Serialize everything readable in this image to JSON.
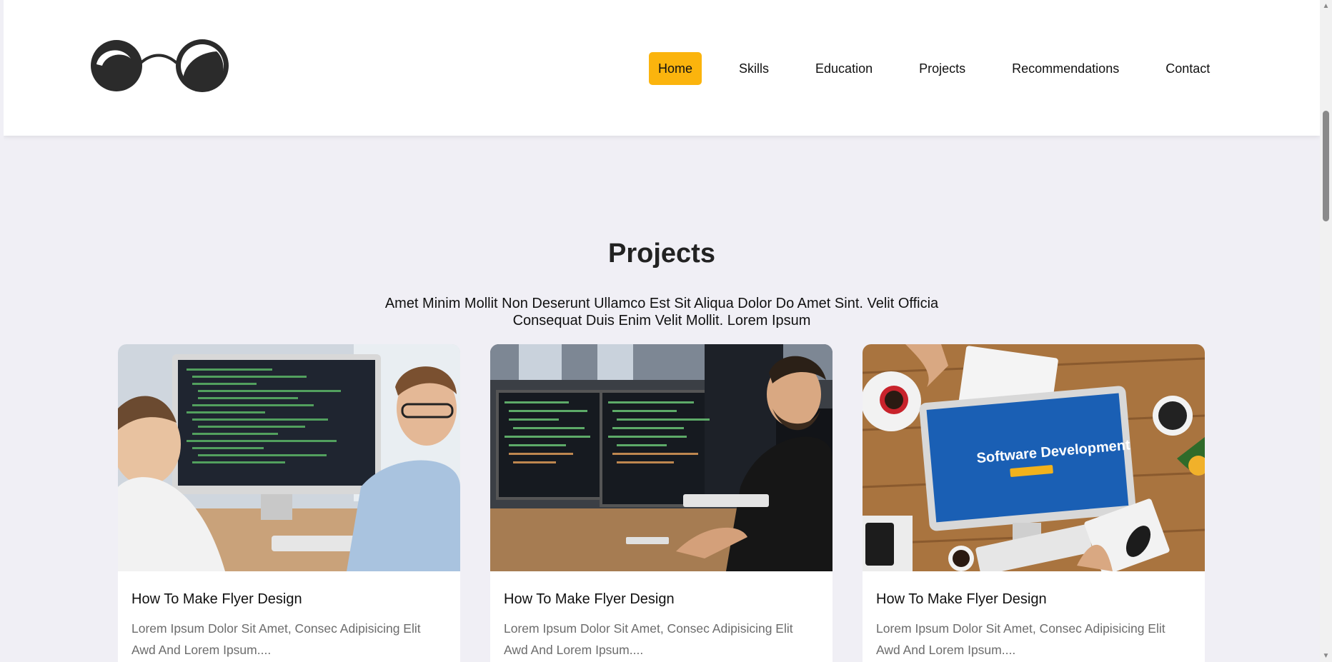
{
  "nav": {
    "items": [
      {
        "label": "Home",
        "active": true
      },
      {
        "label": "Skills",
        "active": false
      },
      {
        "label": "Education",
        "active": false
      },
      {
        "label": "Projects",
        "active": false
      },
      {
        "label": "Recommendations",
        "active": false
      },
      {
        "label": "Contact",
        "active": false
      }
    ],
    "active_color": "#fbb40d"
  },
  "logo": {
    "icon": "glasses-icon"
  },
  "projects": {
    "title": "Projects",
    "subtitle": "Amet Minim Mollit Non Deserunt Ullamco Est Sit Aliqua Dolor Do Amet Sint. Velit Officia Consequat Duis Enim Velit Mollit. Lorem Ipsum",
    "cards": [
      {
        "title": "How To Make Flyer Design",
        "text": "Lorem Ipsum Dolor Sit Amet, Consec Adipisicing Elit Awd And Lorem Ipsum....",
        "image": "two-developers-at-computer"
      },
      {
        "title": "How To Make Flyer Design",
        "text": "Lorem Ipsum Dolor Sit Amet, Consec Adipisicing Elit Awd And Lorem Ipsum....",
        "image": "developer-with-monitors"
      },
      {
        "title": "How To Make Flyer Design",
        "text": "Lorem Ipsum Dolor Sit Amet, Consec Adipisicing Elit Awd And Lorem Ipsum....",
        "image": "desk-with-software-development-screen",
        "screen_text": "Software Development"
      }
    ]
  },
  "colors": {
    "background": "#f0eff5",
    "header": "#ffffff",
    "accent": "#fbb40d"
  }
}
